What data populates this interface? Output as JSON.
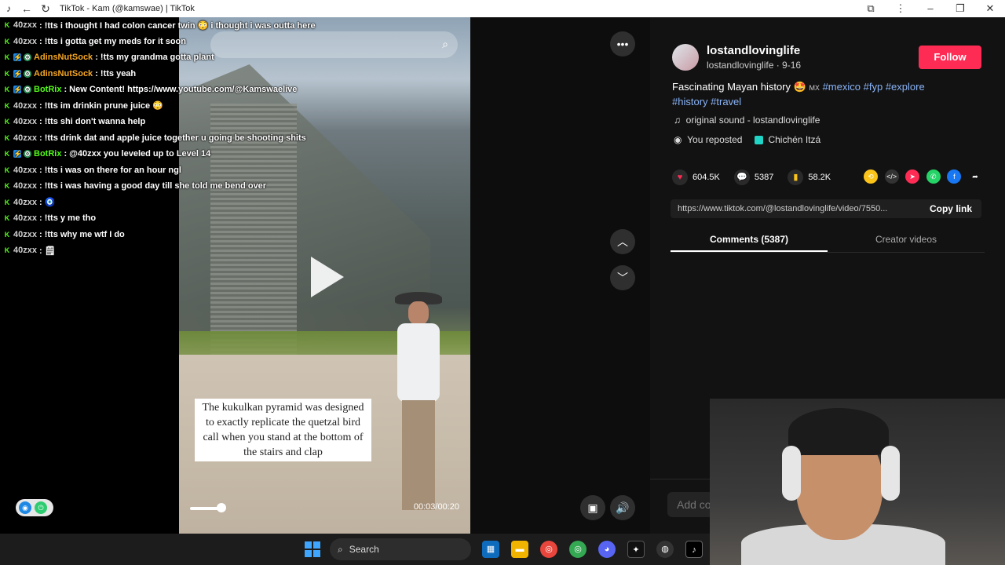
{
  "window": {
    "title": "TikTok - Kam (@kamswae) | TikTok"
  },
  "chat": [
    {
      "user": "40zxx",
      "color": "#cfcfcf",
      "badges": [
        "k"
      ],
      "text": ": !tts i thought I had colon cancer twin 😳 i thought i was outta here"
    },
    {
      "user": "40zxx",
      "color": "#cfcfcf",
      "badges": [
        "k"
      ],
      "text": ": !tts i gotta get my meds for it soon"
    },
    {
      "user": "AdinsNutSock",
      "color": "#f5a623",
      "badges": [
        "k",
        "b",
        "g"
      ],
      "text": ": !tts my grandma gotta plant"
    },
    {
      "user": "AdinsNutSock",
      "color": "#f5a623",
      "badges": [
        "k",
        "b",
        "g"
      ],
      "text": ": !tts yeah"
    },
    {
      "user": "BotRix",
      "color": "#53fc18",
      "badges": [
        "k",
        "b",
        "g"
      ],
      "text": ": New Content! https://www.youtube.com/@Kamswaelive"
    },
    {
      "user": "40zxx",
      "color": "#cfcfcf",
      "badges": [
        "k"
      ],
      "text": ": !tts im drinkin prune juice 😳"
    },
    {
      "user": "40zxx",
      "color": "#cfcfcf",
      "badges": [
        "k"
      ],
      "text": ": !tts shi don't wanna help"
    },
    {
      "user": "40zxx",
      "color": "#cfcfcf",
      "badges": [
        "k"
      ],
      "text": ": !tts drink dat and apple juice together u going be shooting shits"
    },
    {
      "user": "BotRix",
      "color": "#53fc18",
      "badges": [
        "k",
        "b",
        "g"
      ],
      "text": ": @40zxx you leveled up to Level 14"
    },
    {
      "user": "40zxx",
      "color": "#cfcfcf",
      "badges": [
        "k"
      ],
      "text": ": !tts i was on there for an hour ngl"
    },
    {
      "user": "40zxx",
      "color": "#cfcfcf",
      "badges": [
        "k"
      ],
      "text": ": !tts i was having a good day till she told me bend over"
    },
    {
      "user": "40zxx",
      "color": "#cfcfcf",
      "badges": [
        "k"
      ],
      "text": ": 🧿"
    },
    {
      "user": "40zxx",
      "color": "#cfcfcf",
      "badges": [
        "k"
      ],
      "text": ": !tts y me tho"
    },
    {
      "user": "40zxx",
      "color": "#cfcfcf",
      "badges": [
        "k"
      ],
      "text": ": !tts why me wtf I do"
    },
    {
      "user": "40zxx",
      "color": "#cfcfcf",
      "badges": [
        "k"
      ],
      "text": ": 🗒"
    }
  ],
  "video": {
    "caption": "The kukulkan pyramid was designed to exactly replicate the quetzal bird call when you stand at the bottom of the stairs and clap",
    "time": "00:03/00:20"
  },
  "post": {
    "author_name": "lostandlovinglife",
    "author_sub": "lostandlovinglife · 9-16",
    "follow_label": "Follow",
    "desc_text": "Fascinating Mayan history 🤩",
    "desc_flag": "MX",
    "hashtags": [
      "#mexico",
      "#fyp",
      "#explore",
      "#history",
      "#travel"
    ],
    "music": "original sound - lostandlovinglife",
    "repost_label": "You reposted",
    "location": "Chichén Itzá",
    "likes": "604.5K",
    "comments": "5387",
    "saves": "58.2K",
    "link": "https://www.tiktok.com/@lostandlovinglife/video/7550...",
    "copy_label": "Copy link",
    "tab_comments": "Comments (5387)",
    "tab_creator": "Creator videos",
    "comment_placeholder": "Add comment..."
  },
  "taskbar": {
    "search_label": "Search"
  },
  "colors": {
    "accent": "#fe2c55",
    "hashtag": "#8ab4f8",
    "kick_green": "#53fc18"
  }
}
